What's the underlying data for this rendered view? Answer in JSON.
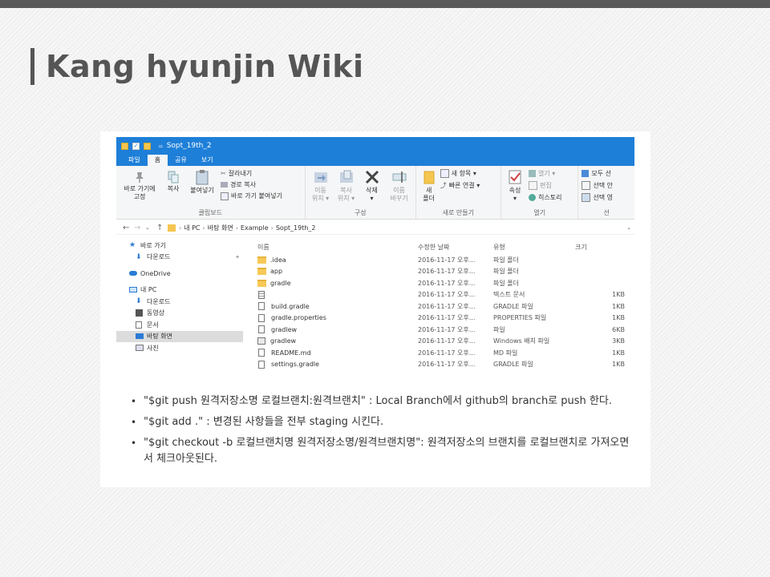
{
  "slide": {
    "title": "Kang hyunjin Wiki"
  },
  "explorer": {
    "window_title": "Sopt_19th_2",
    "menu_tabs": [
      "파일",
      "홈",
      "공유",
      "보기"
    ],
    "ribbon": {
      "clipboard": {
        "pin_label_1": "바로 가기에",
        "pin_label_2": "고정",
        "copy_label": "복사",
        "paste_label": "붙여넣기",
        "cut_label": "잘라내기",
        "copy_path_label": "경로 복사",
        "paste_shortcut_label": "바로 가기 붙여넣기",
        "group_label": "클립보드"
      },
      "organize": {
        "move_label_1": "이동",
        "move_label_2": "위치 ▾",
        "copyto_label_1": "복사",
        "copyto_label_2": "위치 ▾",
        "delete_label_1": "삭제",
        "delete_label_2": "▾",
        "rename_label_1": "이름",
        "rename_label_2": "바꾸기",
        "group_label": "구성"
      },
      "new": {
        "new_folder_label_1": "새",
        "new_folder_label_2": "폴더",
        "new_item_label": "새 항목 ▾",
        "easy_access_label": "빠른 연결 ▾",
        "group_label": "새로 만들기"
      },
      "open": {
        "properties_label_1": "속성",
        "properties_label_2": "▾",
        "open_label": "열기 ▾",
        "edit_label": "편집",
        "history_label": "히스토리",
        "group_label": "열기"
      },
      "select": {
        "select_all_label": "모두 선",
        "select_none_label": "선택 안",
        "invert_label": "선택 영",
        "group_label": "선"
      }
    },
    "address": {
      "crumbs": [
        "내 PC",
        "바탕 화면",
        "Example",
        "Sopt_19th_2"
      ]
    },
    "nav": {
      "items": [
        {
          "label": "바로 가기",
          "icon": "star-icon",
          "indent": false,
          "selected": false
        },
        {
          "label": "다운로드",
          "icon": "download-icon",
          "indent": true,
          "selected": false,
          "pinned": true
        },
        {
          "label": "OneDrive",
          "icon": "cloud-icon",
          "indent": false,
          "selected": false
        },
        {
          "label": "내 PC",
          "icon": "pc-icon",
          "indent": false,
          "selected": false
        },
        {
          "label": "다운로드",
          "icon": "download-icon",
          "indent": true,
          "selected": false
        },
        {
          "label": "동영상",
          "icon": "video-icon",
          "indent": true,
          "selected": false
        },
        {
          "label": "문서",
          "icon": "document-icon",
          "indent": true,
          "selected": false
        },
        {
          "label": "바탕 화면",
          "icon": "desktop-icon",
          "indent": true,
          "selected": true
        },
        {
          "label": "사진",
          "icon": "picture-icon",
          "indent": true,
          "selected": false
        }
      ]
    },
    "columns": {
      "name": "이름",
      "date": "수정한 날짜",
      "type": "유형",
      "size": "크기"
    },
    "files": [
      {
        "name": ".idea",
        "date": "2016-11-17 오후...",
        "type": "파일 폴더",
        "size": "",
        "icon": "folder-icon"
      },
      {
        "name": "app",
        "date": "2016-11-17 오후...",
        "type": "파일 폴더",
        "size": "",
        "icon": "folder-icon"
      },
      {
        "name": "gradle",
        "date": "2016-11-17 오후...",
        "type": "파일 폴더",
        "size": "",
        "icon": "folder-icon"
      },
      {
        "name": "",
        "date": "2016-11-17 오후...",
        "type": "텍스트 문서",
        "size": "1KB",
        "icon": "text-file-icon"
      },
      {
        "name": "build.gradle",
        "date": "2016-11-17 오후...",
        "type": "GRADLE 파일",
        "size": "1KB",
        "icon": "file-icon"
      },
      {
        "name": "gradle.properties",
        "date": "2016-11-17 오후...",
        "type": "PROPERTIES 파일",
        "size": "1KB",
        "icon": "file-icon"
      },
      {
        "name": "gradlew",
        "date": "2016-11-17 오후...",
        "type": "파일",
        "size": "6KB",
        "icon": "file-icon"
      },
      {
        "name": "gradlew",
        "date": "2016-11-17 오후...",
        "type": "Windows 배치 파일",
        "size": "3KB",
        "icon": "batch-file-icon"
      },
      {
        "name": "README.md",
        "date": "2016-11-17 오후...",
        "type": "MD 파일",
        "size": "1KB",
        "icon": "file-icon"
      },
      {
        "name": "settings.gradle",
        "date": "2016-11-17 오후...",
        "type": "GRADLE 파일",
        "size": "1KB",
        "icon": "file-icon"
      }
    ]
  },
  "bullets": [
    {
      "text": "\"$git push 원격저장소명 로컬브랜치:원격브랜치\" : Local Branch에서 github의 branch로 push 한다."
    },
    {
      "text": "\"$git add .\" : 변경된 사항들을 전부 staging 시킨다."
    },
    {
      "text": "\"$git checkout -b 로컬브랜치명 원격저장소명/원격브랜치명\": 원격저장소의 브랜치를 로컬브랜치로 가져오면서 체크아웃된다."
    }
  ]
}
